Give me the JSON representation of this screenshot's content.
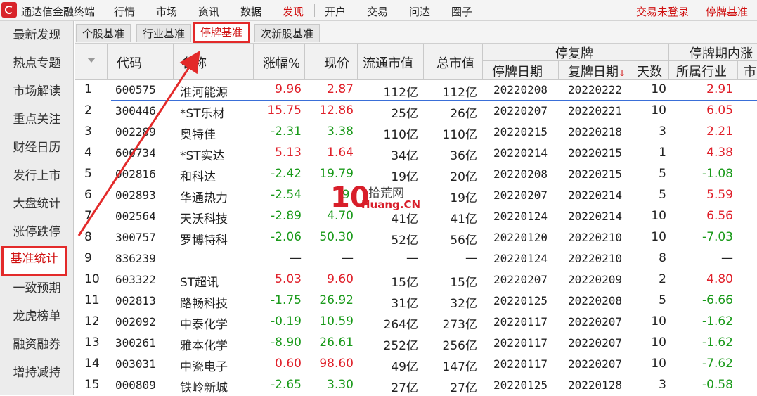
{
  "app": {
    "title": "通达信金融终端"
  },
  "menu": [
    {
      "label": "行情"
    },
    {
      "label": "市场"
    },
    {
      "label": "资讯"
    },
    {
      "label": "数据"
    },
    {
      "label": "发现"
    },
    {
      "label": "开户"
    },
    {
      "label": "交易"
    },
    {
      "label": "问达"
    },
    {
      "label": "圈子"
    }
  ],
  "menu_active": "发现",
  "header_right": {
    "login": "交易未登录",
    "suspend": "停牌基准"
  },
  "sidebar": {
    "items": [
      {
        "label": "最新发现"
      },
      {
        "label": "热点专题"
      },
      {
        "label": "市场解读"
      },
      {
        "label": "重点关注"
      },
      {
        "label": "财经日历"
      },
      {
        "label": "发行上市"
      },
      {
        "label": "大盘统计"
      },
      {
        "label": "涨停跌停"
      },
      {
        "label": "基准统计"
      },
      {
        "label": "一致预期"
      },
      {
        "label": "龙虎榜单"
      },
      {
        "label": "融资融券"
      },
      {
        "label": "增持减持"
      }
    ],
    "active": "基准统计"
  },
  "tabs": [
    {
      "label": "个股基准"
    },
    {
      "label": "行业基准"
    },
    {
      "label": "停牌基准"
    },
    {
      "label": "次新股基准"
    }
  ],
  "active_tab": "停牌基准",
  "table": {
    "headers": {
      "code": "代码",
      "name": "名称",
      "change": "涨幅%",
      "price": "现价",
      "float_cap": "流通市值",
      "total_cap": "总市值",
      "group_resume": "停复牌",
      "suspend_date": "停牌日期",
      "resume_date": "复牌日期",
      "days": "天数",
      "group_period": "停牌期内涨",
      "industry": "所属行业",
      "market": "市"
    },
    "rows": [
      {
        "idx": "1",
        "code": "600575",
        "name": "淮河能源",
        "change": "9.96",
        "price": "2.87",
        "float": "112亿",
        "total": "112亿",
        "sdate": "20220208",
        "rdate": "20220222",
        "days": "10",
        "ind": "2.91"
      },
      {
        "idx": "2",
        "code": "300446",
        "name": "*ST乐材",
        "change": "15.75",
        "price": "12.86",
        "float": "25亿",
        "total": "26亿",
        "sdate": "20220207",
        "rdate": "20220221",
        "days": "10",
        "ind": "6.05"
      },
      {
        "idx": "3",
        "code": "002289",
        "name": "奥特佳",
        "change": "-2.31",
        "price": "3.38",
        "float": "110亿",
        "total": "110亿",
        "sdate": "20220215",
        "rdate": "20220218",
        "days": "3",
        "ind": "2.21"
      },
      {
        "idx": "4",
        "code": "600734",
        "name": "*ST实达",
        "change": "5.13",
        "price": "1.64",
        "float": "34亿",
        "total": "36亿",
        "sdate": "20220214",
        "rdate": "20220215",
        "days": "1",
        "ind": "4.38"
      },
      {
        "idx": "5",
        "code": "002816",
        "name": "和科达",
        "change": "-2.42",
        "price": "19.79",
        "float": "19亿",
        "total": "20亿",
        "sdate": "20220208",
        "rdate": "20220215",
        "days": "5",
        "ind": "-1.08"
      },
      {
        "idx": "6",
        "code": "002893",
        "name": "华通热力",
        "change": "-2.54",
        "price": "9.",
        "float": "",
        "total": "19亿",
        "sdate": "20220207",
        "rdate": "20220214",
        "days": "5",
        "ind": "5.59"
      },
      {
        "idx": "7",
        "code": "002564",
        "name": "天沃科技",
        "change": "-2.89",
        "price": "4.70",
        "float": "41亿",
        "total": "41亿",
        "sdate": "20220124",
        "rdate": "20220214",
        "days": "10",
        "ind": "6.56"
      },
      {
        "idx": "8",
        "code": "300757",
        "name": "罗博特科",
        "change": "-2.06",
        "price": "50.30",
        "float": "52亿",
        "total": "56亿",
        "sdate": "20220120",
        "rdate": "20220210",
        "days": "10",
        "ind": "-7.03"
      },
      {
        "idx": "9",
        "code": "836239",
        "name": "",
        "change": "—",
        "price": "—",
        "float": "—",
        "total": "—",
        "sdate": "20220124",
        "rdate": "20220210",
        "days": "8",
        "ind": "—"
      },
      {
        "idx": "10",
        "code": "603322",
        "name": "ST超讯",
        "change": "5.03",
        "price": "9.60",
        "float": "15亿",
        "total": "15亿",
        "sdate": "20220207",
        "rdate": "20220209",
        "days": "2",
        "ind": "4.80"
      },
      {
        "idx": "11",
        "code": "002813",
        "name": "路畅科技",
        "change": "-1.75",
        "price": "26.92",
        "float": "31亿",
        "total": "32亿",
        "sdate": "20220125",
        "rdate": "20220208",
        "days": "5",
        "ind": "-6.66"
      },
      {
        "idx": "12",
        "code": "002092",
        "name": "中泰化学",
        "change": "-0.19",
        "price": "10.59",
        "float": "264亿",
        "total": "273亿",
        "sdate": "20220117",
        "rdate": "20220207",
        "days": "10",
        "ind": "-1.62"
      },
      {
        "idx": "13",
        "code": "300261",
        "name": "雅本化学",
        "change": "-8.90",
        "price": "26.61",
        "float": "252亿",
        "total": "256亿",
        "sdate": "20220117",
        "rdate": "20220207",
        "days": "10",
        "ind": "-1.62"
      },
      {
        "idx": "14",
        "code": "003031",
        "name": "中瓷电子",
        "change": "0.60",
        "price": "98.60",
        "float": "49亿",
        "total": "147亿",
        "sdate": "20220117",
        "rdate": "20220207",
        "days": "10",
        "ind": "-7.62"
      },
      {
        "idx": "15",
        "code": "000809",
        "name": "铁岭新城",
        "change": "-2.65",
        "price": "3.30",
        "float": "27亿",
        "total": "27亿",
        "sdate": "20220125",
        "rdate": "20220128",
        "days": "3",
        "ind": "-0.58"
      }
    ]
  },
  "watermark": {
    "ten": "10",
    "top": "拾荒网",
    "bottom": "Huang.CN"
  },
  "colors": {
    "up": "#e0202a",
    "down": "#1a9a1a",
    "accent": "#e32a2a",
    "selection": "#3a6fd8"
  }
}
